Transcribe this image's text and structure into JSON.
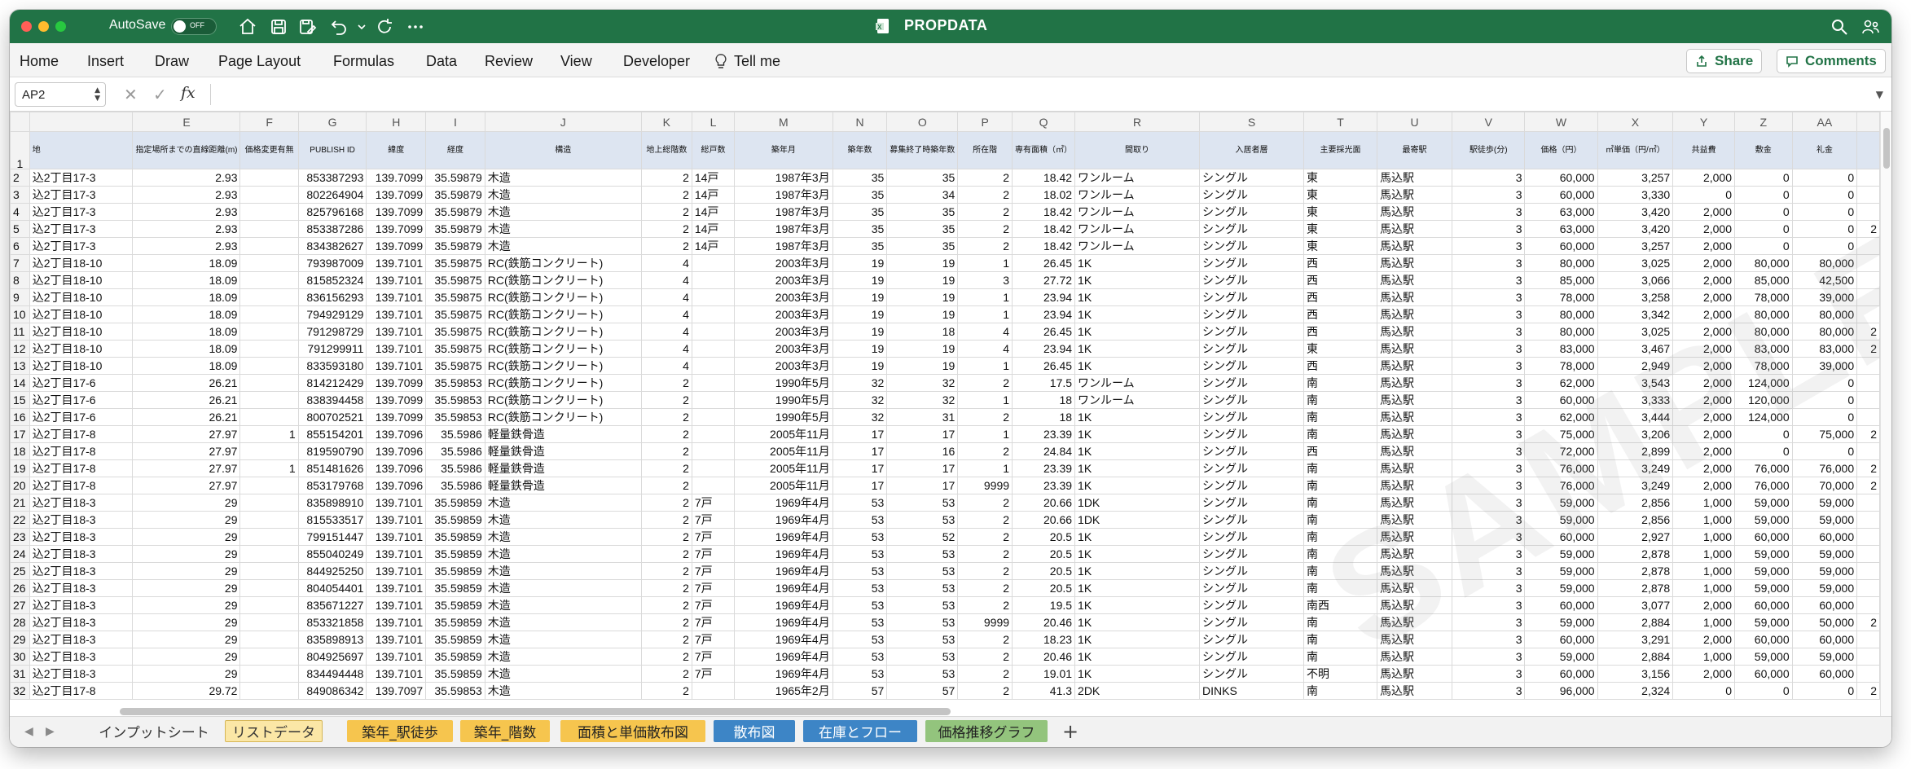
{
  "titlebar": {
    "autosave_label": "AutoSave",
    "autosave_state": "OFF",
    "doc_title": "PROPDATA"
  },
  "ribbon": {
    "tabs": [
      "Home",
      "Insert",
      "Draw",
      "Page Layout",
      "Formulas",
      "Data",
      "Review",
      "View",
      "Developer",
      "Tell me"
    ],
    "share_label": "Share",
    "comments_label": "Comments"
  },
  "formula_bar": {
    "name_box": "AP2",
    "fx_label": "fx",
    "content": ""
  },
  "columns": [
    "",
    "E",
    "F",
    "G",
    "H",
    "I",
    "J",
    "K",
    "L",
    "M",
    "N",
    "O",
    "P",
    "Q",
    "R",
    "S",
    "T",
    "U",
    "V",
    "W",
    "X",
    "Y",
    "Z",
    "AA",
    ""
  ],
  "headers": [
    "地",
    "指定場所までの直線距離(m)",
    "価格変更有無",
    "PUBLISH ID",
    "緯度",
    "経度",
    "構造",
    "地上総階数",
    "総戸数",
    "築年月",
    "築年数",
    "募集終了時築年数",
    "所在階",
    "専有面積（㎡）",
    "間取り",
    "入居者層",
    "主要採光面",
    "最寄駅",
    "駅徒歩(分)",
    "価格（円）",
    "㎡単価（円/㎡）",
    "共益費",
    "敷金",
    "礼金",
    ""
  ],
  "rows": [
    [
      "込2丁目17-3",
      "2.93",
      "",
      "853387293",
      "139.7099",
      "35.59879",
      "木造",
      "2",
      "14戸",
      "1987年3月",
      "35",
      "35",
      "2",
      "18.42",
      "ワンルーム",
      "シングル",
      "東",
      "馬込駅",
      "3",
      "60,000",
      "3,257",
      "2,000",
      "0",
      "0",
      ""
    ],
    [
      "込2丁目17-3",
      "2.93",
      "",
      "802264904",
      "139.7099",
      "35.59879",
      "木造",
      "2",
      "14戸",
      "1987年3月",
      "35",
      "34",
      "2",
      "18.02",
      "ワンルーム",
      "シングル",
      "東",
      "馬込駅",
      "3",
      "60,000",
      "3,330",
      "0",
      "0",
      "0",
      ""
    ],
    [
      "込2丁目17-3",
      "2.93",
      "",
      "825796168",
      "139.7099",
      "35.59879",
      "木造",
      "2",
      "14戸",
      "1987年3月",
      "35",
      "35",
      "2",
      "18.42",
      "ワンルーム",
      "シングル",
      "東",
      "馬込駅",
      "3",
      "63,000",
      "3,420",
      "2,000",
      "0",
      "0",
      ""
    ],
    [
      "込2丁目17-3",
      "2.93",
      "",
      "853387286",
      "139.7099",
      "35.59879",
      "木造",
      "2",
      "14戸",
      "1987年3月",
      "35",
      "35",
      "2",
      "18.42",
      "ワンルーム",
      "シングル",
      "東",
      "馬込駅",
      "3",
      "63,000",
      "3,420",
      "2,000",
      "0",
      "0",
      "2"
    ],
    [
      "込2丁目17-3",
      "2.93",
      "",
      "834382627",
      "139.7099",
      "35.59879",
      "木造",
      "2",
      "14戸",
      "1987年3月",
      "35",
      "35",
      "2",
      "18.42",
      "ワンルーム",
      "シングル",
      "東",
      "馬込駅",
      "3",
      "60,000",
      "3,257",
      "2,000",
      "0",
      "0",
      ""
    ],
    [
      "込2丁目18-10",
      "18.09",
      "",
      "793987009",
      "139.7101",
      "35.59875",
      "RC(鉄筋コンクリート)",
      "4",
      "",
      "2003年3月",
      "19",
      "19",
      "1",
      "26.45",
      "1K",
      "シングル",
      "西",
      "馬込駅",
      "3",
      "80,000",
      "3,025",
      "2,000",
      "80,000",
      "80,000",
      ""
    ],
    [
      "込2丁目18-10",
      "18.09",
      "",
      "815852324",
      "139.7101",
      "35.59875",
      "RC(鉄筋コンクリート)",
      "4",
      "",
      "2003年3月",
      "19",
      "19",
      "3",
      "27.72",
      "1K",
      "シングル",
      "西",
      "馬込駅",
      "3",
      "85,000",
      "3,066",
      "2,000",
      "85,000",
      "42,500",
      ""
    ],
    [
      "込2丁目18-10",
      "18.09",
      "",
      "836156293",
      "139.7101",
      "35.59875",
      "RC(鉄筋コンクリート)",
      "4",
      "",
      "2003年3月",
      "19",
      "19",
      "1",
      "23.94",
      "1K",
      "シングル",
      "西",
      "馬込駅",
      "3",
      "78,000",
      "3,258",
      "2,000",
      "78,000",
      "39,000",
      ""
    ],
    [
      "込2丁目18-10",
      "18.09",
      "",
      "794929129",
      "139.7101",
      "35.59875",
      "RC(鉄筋コンクリート)",
      "4",
      "",
      "2003年3月",
      "19",
      "19",
      "1",
      "23.94",
      "1K",
      "シングル",
      "西",
      "馬込駅",
      "3",
      "80,000",
      "3,342",
      "2,000",
      "80,000",
      "80,000",
      ""
    ],
    [
      "込2丁目18-10",
      "18.09",
      "",
      "791298729",
      "139.7101",
      "35.59875",
      "RC(鉄筋コンクリート)",
      "4",
      "",
      "2003年3月",
      "19",
      "18",
      "4",
      "26.45",
      "1K",
      "シングル",
      "西",
      "馬込駅",
      "3",
      "80,000",
      "3,025",
      "2,000",
      "80,000",
      "80,000",
      "2"
    ],
    [
      "込2丁目18-10",
      "18.09",
      "",
      "791299911",
      "139.7101",
      "35.59875",
      "RC(鉄筋コンクリート)",
      "4",
      "",
      "2003年3月",
      "19",
      "19",
      "4",
      "23.94",
      "1K",
      "シングル",
      "東",
      "馬込駅",
      "3",
      "83,000",
      "3,467",
      "2,000",
      "83,000",
      "83,000",
      "2"
    ],
    [
      "込2丁目18-10",
      "18.09",
      "",
      "833593180",
      "139.7101",
      "35.59875",
      "RC(鉄筋コンクリート)",
      "4",
      "",
      "2003年3月",
      "19",
      "19",
      "1",
      "26.45",
      "1K",
      "シングル",
      "西",
      "馬込駅",
      "3",
      "78,000",
      "2,949",
      "2,000",
      "78,000",
      "39,000",
      ""
    ],
    [
      "込2丁目17-6",
      "26.21",
      "",
      "814212429",
      "139.7099",
      "35.59853",
      "RC(鉄筋コンクリート)",
      "2",
      "",
      "1990年5月",
      "32",
      "32",
      "2",
      "17.5",
      "ワンルーム",
      "シングル",
      "南",
      "馬込駅",
      "3",
      "62,000",
      "3,543",
      "2,000",
      "124,000",
      "0",
      ""
    ],
    [
      "込2丁目17-6",
      "26.21",
      "",
      "838394458",
      "139.7099",
      "35.59853",
      "RC(鉄筋コンクリート)",
      "2",
      "",
      "1990年5月",
      "32",
      "32",
      "1",
      "18",
      "ワンルーム",
      "シングル",
      "南",
      "馬込駅",
      "3",
      "60,000",
      "3,333",
      "2,000",
      "120,000",
      "0",
      ""
    ],
    [
      "込2丁目17-6",
      "26.21",
      "",
      "800702521",
      "139.7099",
      "35.59853",
      "RC(鉄筋コンクリート)",
      "2",
      "",
      "1990年5月",
      "32",
      "31",
      "2",
      "18",
      "1K",
      "シングル",
      "南",
      "馬込駅",
      "3",
      "62,000",
      "3,444",
      "2,000",
      "124,000",
      "0",
      ""
    ],
    [
      "込2丁目17-8",
      "27.97",
      "1",
      "855154201",
      "139.7096",
      "35.5986",
      "軽量鉄骨造",
      "2",
      "",
      "2005年11月",
      "17",
      "17",
      "1",
      "23.39",
      "1K",
      "シングル",
      "南",
      "馬込駅",
      "3",
      "75,000",
      "3,206",
      "2,000",
      "0",
      "75,000",
      "2"
    ],
    [
      "込2丁目17-8",
      "27.97",
      "",
      "819590790",
      "139.7096",
      "35.5986",
      "軽量鉄骨造",
      "2",
      "",
      "2005年11月",
      "17",
      "16",
      "2",
      "24.84",
      "1K",
      "シングル",
      "西",
      "馬込駅",
      "3",
      "72,000",
      "2,899",
      "2,000",
      "0",
      "0",
      ""
    ],
    [
      "込2丁目17-8",
      "27.97",
      "1",
      "851481626",
      "139.7096",
      "35.5986",
      "軽量鉄骨造",
      "2",
      "",
      "2005年11月",
      "17",
      "17",
      "1",
      "23.39",
      "1K",
      "シングル",
      "南",
      "馬込駅",
      "3",
      "76,000",
      "3,249",
      "2,000",
      "76,000",
      "76,000",
      "2"
    ],
    [
      "込2丁目17-8",
      "27.97",
      "",
      "853179768",
      "139.7096",
      "35.5986",
      "軽量鉄骨造",
      "2",
      "",
      "2005年11月",
      "17",
      "17",
      "9999",
      "23.39",
      "1K",
      "シングル",
      "南",
      "馬込駅",
      "3",
      "76,000",
      "3,249",
      "2,000",
      "76,000",
      "70,000",
      "2"
    ],
    [
      "込2丁目18-3",
      "29",
      "",
      "835898910",
      "139.7101",
      "35.59859",
      "木造",
      "2",
      "7戸",
      "1969年4月",
      "53",
      "53",
      "2",
      "20.66",
      "1DK",
      "シングル",
      "南",
      "馬込駅",
      "3",
      "59,000",
      "2,856",
      "1,000",
      "59,000",
      "59,000",
      ""
    ],
    [
      "込2丁目18-3",
      "29",
      "",
      "815533517",
      "139.7101",
      "35.59859",
      "木造",
      "2",
      "7戸",
      "1969年4月",
      "53",
      "53",
      "2",
      "20.66",
      "1DK",
      "シングル",
      "南",
      "馬込駅",
      "3",
      "59,000",
      "2,856",
      "1,000",
      "59,000",
      "59,000",
      ""
    ],
    [
      "込2丁目18-3",
      "29",
      "",
      "799151447",
      "139.7101",
      "35.59859",
      "木造",
      "2",
      "7戸",
      "1969年4月",
      "53",
      "52",
      "2",
      "20.5",
      "1K",
      "シングル",
      "南",
      "馬込駅",
      "3",
      "60,000",
      "2,927",
      "1,000",
      "60,000",
      "60,000",
      ""
    ],
    [
      "込2丁目18-3",
      "29",
      "",
      "855040249",
      "139.7101",
      "35.59859",
      "木造",
      "2",
      "7戸",
      "1969年4月",
      "53",
      "53",
      "2",
      "20.5",
      "1K",
      "シングル",
      "南",
      "馬込駅",
      "3",
      "59,000",
      "2,878",
      "1,000",
      "59,000",
      "59,000",
      ""
    ],
    [
      "込2丁目18-3",
      "29",
      "",
      "844925250",
      "139.7101",
      "35.59859",
      "木造",
      "2",
      "7戸",
      "1969年4月",
      "53",
      "53",
      "2",
      "20.5",
      "1K",
      "シングル",
      "南",
      "馬込駅",
      "3",
      "59,000",
      "2,878",
      "1,000",
      "59,000",
      "59,000",
      ""
    ],
    [
      "込2丁目18-3",
      "29",
      "",
      "804054401",
      "139.7101",
      "35.59859",
      "木造",
      "2",
      "7戸",
      "1969年4月",
      "53",
      "53",
      "2",
      "20.5",
      "1K",
      "シングル",
      "南",
      "馬込駅",
      "3",
      "59,000",
      "2,878",
      "1,000",
      "59,000",
      "59,000",
      ""
    ],
    [
      "込2丁目18-3",
      "29",
      "",
      "835671227",
      "139.7101",
      "35.59859",
      "木造",
      "2",
      "7戸",
      "1969年4月",
      "53",
      "53",
      "2",
      "19.5",
      "1K",
      "シングル",
      "南西",
      "馬込駅",
      "3",
      "60,000",
      "3,077",
      "2,000",
      "60,000",
      "60,000",
      ""
    ],
    [
      "込2丁目18-3",
      "29",
      "",
      "853321858",
      "139.7101",
      "35.59859",
      "木造",
      "2",
      "7戸",
      "1969年4月",
      "53",
      "53",
      "9999",
      "20.46",
      "1K",
      "シングル",
      "南",
      "馬込駅",
      "3",
      "59,000",
      "2,884",
      "1,000",
      "59,000",
      "50,000",
      "2"
    ],
    [
      "込2丁目18-3",
      "29",
      "",
      "835898913",
      "139.7101",
      "35.59859",
      "木造",
      "2",
      "7戸",
      "1969年4月",
      "53",
      "53",
      "2",
      "18.23",
      "1K",
      "シングル",
      "南",
      "馬込駅",
      "3",
      "60,000",
      "3,291",
      "2,000",
      "60,000",
      "60,000",
      ""
    ],
    [
      "込2丁目18-3",
      "29",
      "",
      "804925697",
      "139.7101",
      "35.59859",
      "木造",
      "2",
      "7戸",
      "1969年4月",
      "53",
      "53",
      "2",
      "20.46",
      "1K",
      "シングル",
      "南",
      "馬込駅",
      "3",
      "59,000",
      "2,884",
      "1,000",
      "59,000",
      "59,000",
      ""
    ],
    [
      "込2丁目18-3",
      "29",
      "",
      "834494448",
      "139.7101",
      "35.59859",
      "木造",
      "2",
      "7戸",
      "1969年4月",
      "53",
      "53",
      "2",
      "19.01",
      "1K",
      "シングル",
      "不明",
      "馬込駅",
      "3",
      "60,000",
      "3,156",
      "2,000",
      "60,000",
      "60,000",
      ""
    ],
    [
      "込2丁目17-8",
      "29.72",
      "",
      "849086342",
      "139.7097",
      "35.59853",
      "木造",
      "2",
      "",
      "1965年2月",
      "57",
      "57",
      "2",
      "41.3",
      "2DK",
      "DINKS",
      "南",
      "馬込駅",
      "3",
      "96,000",
      "2,324",
      "0",
      "0",
      "0",
      "2"
    ]
  ],
  "sheet_tabs": [
    {
      "label": "インプットシート",
      "color": "#f2f2f2",
      "text_color": "#333333"
    },
    {
      "label": "リストデータ",
      "color": "#fbe7a6",
      "text_color": "#333333",
      "active": true
    },
    {
      "label": "築年_駅徒歩",
      "color": "#f6c54e",
      "text_color": "#222222"
    },
    {
      "label": "築年_階数",
      "color": "#f6c54e",
      "text_color": "#222222"
    },
    {
      "label": "面積と単価散布図",
      "color": "#f6c54e",
      "text_color": "#222222"
    },
    {
      "label": "散布図",
      "color": "#3d85c6",
      "text_color": "#ffffff"
    },
    {
      "label": "在庫とフロー",
      "color": "#3d85c6",
      "text_color": "#ffffff"
    },
    {
      "label": "価格推移グラフ",
      "color": "#93c47d",
      "text_color": "#222222"
    }
  ],
  "watermark": "SAMPLE",
  "colors": {
    "titlebar": "#217346",
    "header_fill": "#dde5f1",
    "accent": "#217346"
  }
}
